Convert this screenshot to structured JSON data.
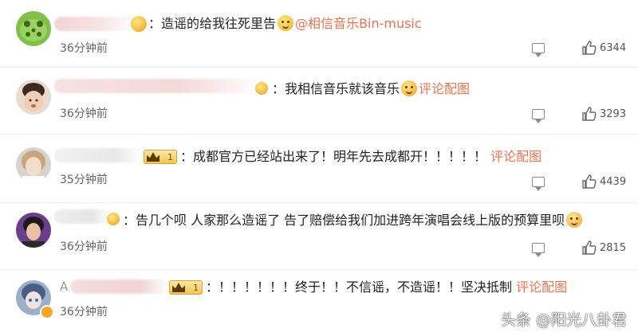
{
  "comments": [
    {
      "avatar": "frog-avatar-icon",
      "text_parts": [
        "：造谣的给我往死里告",
        "@相信音乐Bin-music"
      ],
      "time": "36分钟前",
      "likes": "6344"
    },
    {
      "avatar": "baby-avatar-icon",
      "text_parts": [
        "：我相信音乐就该音乐",
        "评论配图"
      ],
      "time": "36分钟前",
      "likes": "3293"
    },
    {
      "avatar": "woman-avatar-icon",
      "vip_level": "1",
      "text_parts": [
        "：成都官方已经站出来了！明年先去成都开！！！！！",
        "评论配图"
      ],
      "time": "35分钟前",
      "likes": "4439"
    },
    {
      "avatar": "man-avatar-icon",
      "text_parts": [
        "：告几个呗 人家那么造谣了 告了赔偿给我们加进跨年演唱会线上版的预算里呗"
      ],
      "time": "36分钟前",
      "likes": "2815"
    },
    {
      "avatar": "anime-avatar-icon",
      "name_initial": "A",
      "vip_level": "1",
      "text_parts": [
        "：！！！！！！终于！！不信谣，不造谣！！坚决抵制",
        "评论配图"
      ],
      "time": "36分钟前"
    }
  ],
  "watermark": "头条 @阳光八卦君",
  "colors": {
    "link": "#eb7350",
    "divider": "#eceff3",
    "time": "#666666"
  }
}
